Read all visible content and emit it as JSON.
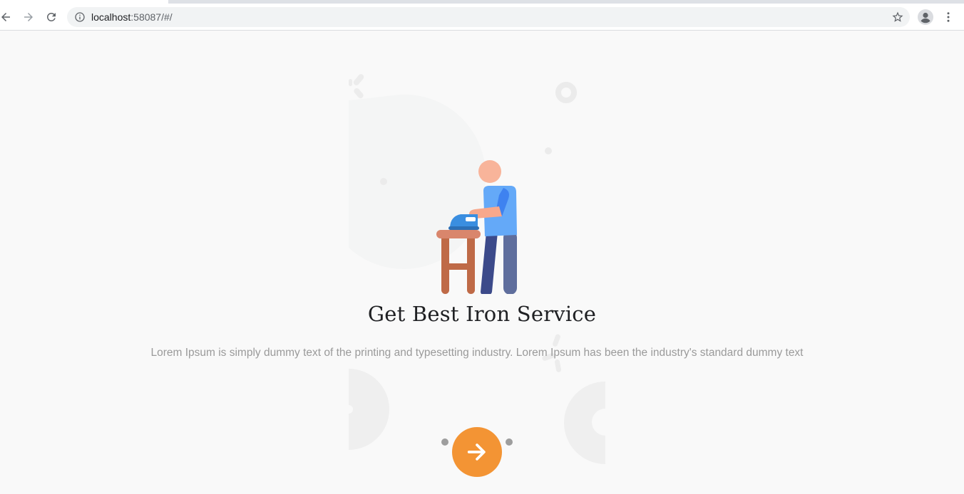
{
  "browser": {
    "url_host": "localhost",
    "url_rest": ":58087/#/",
    "icons": {
      "back": "arrow-left-icon",
      "forward": "arrow-right-icon",
      "reload": "reload-icon",
      "info": "info-circle-icon",
      "bookmark": "star-outline-icon",
      "profile": "account-circle-icon",
      "menu": "more-vertical-icon"
    }
  },
  "onboarding": {
    "title": "Get Best Iron Service",
    "description": "Lorem Ipsum is simply dummy text of the printing and typesetting industry. Lorem Ipsum has been the industry's standard dummy text",
    "illustration": "person-ironing-illustration",
    "next_icon": "arrow-right-icon",
    "accent_color": "#f39434",
    "pagination_total": 2
  }
}
